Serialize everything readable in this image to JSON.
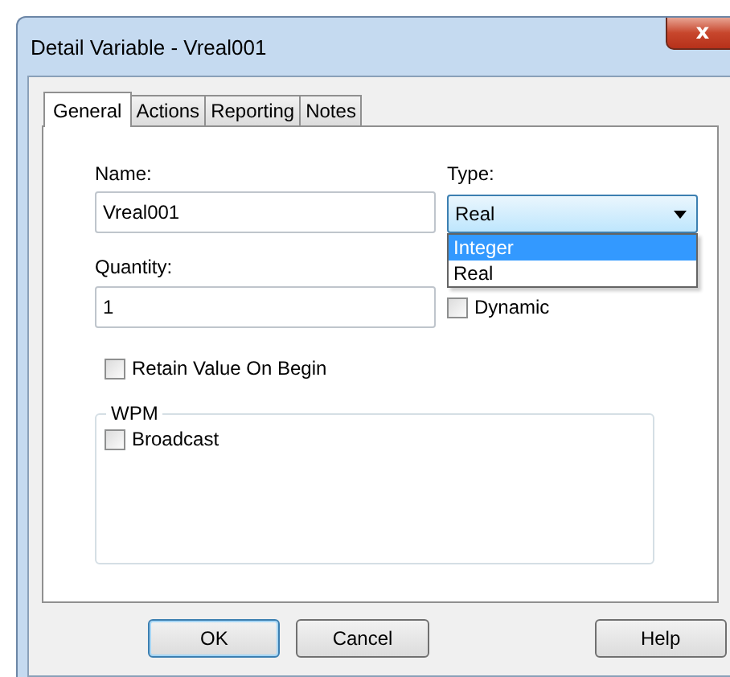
{
  "window": {
    "title": "Detail Variable - Vreal001",
    "close": "x"
  },
  "tabs": [
    {
      "label": "General",
      "selected": true
    },
    {
      "label": "Actions",
      "selected": false
    },
    {
      "label": "Reporting",
      "selected": false
    },
    {
      "label": "Notes",
      "selected": false
    }
  ],
  "name": {
    "label": "Name:",
    "value": "Vreal001"
  },
  "type": {
    "label": "Type:",
    "value": "Real",
    "expanded": true,
    "options": [
      {
        "label": "Integer",
        "highlighted": true
      },
      {
        "label": "Real",
        "highlighted": false
      }
    ]
  },
  "quantity": {
    "label": "Quantity:",
    "value": "1"
  },
  "dynamic": {
    "label": "Dynamic",
    "checked": false
  },
  "retain": {
    "label": "Retain Value On Begin",
    "checked": false
  },
  "wpm": {
    "title": "WPM",
    "broadcast": {
      "label": "Broadcast",
      "checked": false
    }
  },
  "buttons": [
    {
      "label": "OK",
      "default": true
    },
    {
      "label": "Cancel",
      "default": false
    },
    {
      "label": "Help",
      "default": false
    }
  ]
}
